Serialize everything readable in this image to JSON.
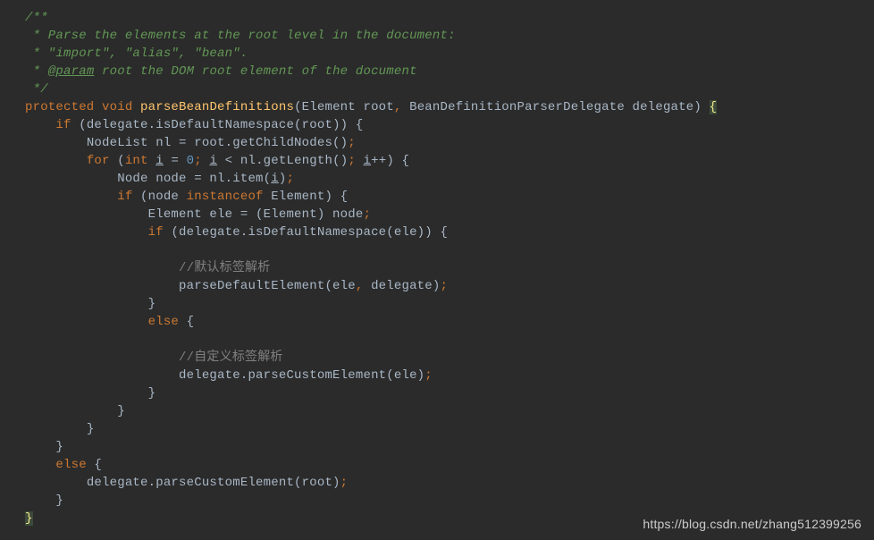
{
  "code": {
    "lines": [
      {
        "indent": 0,
        "segments": [
          {
            "t": "/**",
            "c": "c-docstar"
          }
        ]
      },
      {
        "indent": 0,
        "segments": [
          {
            "t": " * Parse the elements at the root level in the document:",
            "c": "c-docstar"
          }
        ]
      },
      {
        "indent": 0,
        "segments": [
          {
            "t": " * \"import\", \"alias\", \"bean\".",
            "c": "c-docstar"
          }
        ]
      },
      {
        "indent": 0,
        "segments": [
          {
            "t": " * ",
            "c": "c-docstar"
          },
          {
            "t": "@param",
            "c": "c-doctag"
          },
          {
            "t": " root the DOM root element of the document",
            "c": "c-docstar"
          }
        ]
      },
      {
        "indent": 0,
        "segments": [
          {
            "t": " */",
            "c": "c-docstar"
          }
        ]
      },
      {
        "indent": 0,
        "segments": [
          {
            "t": "protected void ",
            "c": "c-keyword"
          },
          {
            "t": "parseBeanDefinitions",
            "c": "c-method"
          },
          {
            "t": "(",
            "c": ""
          },
          {
            "t": "Element root",
            "c": "c-param"
          },
          {
            "t": ", ",
            "c": "c-keyword"
          },
          {
            "t": "BeanDefinitionParserDelegate delegate",
            "c": "c-param"
          },
          {
            "t": ") ",
            "c": ""
          },
          {
            "t": "{",
            "c": "c-brace-hl"
          }
        ]
      },
      {
        "indent": 1,
        "segments": [
          {
            "t": "if ",
            "c": "c-keyword"
          },
          {
            "t": "(delegate.isDefaultNamespace(root)) {",
            "c": ""
          }
        ]
      },
      {
        "indent": 2,
        "segments": [
          {
            "t": "NodeList nl = root.getChildNodes()",
            "c": ""
          },
          {
            "t": ";",
            "c": "c-keyword"
          }
        ]
      },
      {
        "indent": 2,
        "segments": [
          {
            "t": "for ",
            "c": "c-keyword"
          },
          {
            "t": "(",
            "c": ""
          },
          {
            "t": "int ",
            "c": "c-keyword"
          },
          {
            "t": "i",
            "c": "c-underline"
          },
          {
            "t": " = ",
            "c": ""
          },
          {
            "t": "0",
            "c": "c-number"
          },
          {
            "t": "; ",
            "c": "c-keyword"
          },
          {
            "t": "i",
            "c": "c-underline"
          },
          {
            "t": " < nl.getLength()",
            "c": ""
          },
          {
            "t": "; ",
            "c": "c-keyword"
          },
          {
            "t": "i",
            "c": "c-underline"
          },
          {
            "t": "++) {",
            "c": ""
          }
        ]
      },
      {
        "indent": 3,
        "segments": [
          {
            "t": "Node node = nl.item(",
            "c": ""
          },
          {
            "t": "i",
            "c": "c-underline"
          },
          {
            "t": ")",
            "c": ""
          },
          {
            "t": ";",
            "c": "c-keyword"
          }
        ]
      },
      {
        "indent": 3,
        "segments": [
          {
            "t": "if ",
            "c": "c-keyword"
          },
          {
            "t": "(node ",
            "c": ""
          },
          {
            "t": "instanceof ",
            "c": "c-keyword"
          },
          {
            "t": "Element) {",
            "c": ""
          }
        ]
      },
      {
        "indent": 4,
        "segments": [
          {
            "t": "Element ele = (Element) node",
            "c": ""
          },
          {
            "t": ";",
            "c": "c-keyword"
          }
        ]
      },
      {
        "indent": 4,
        "segments": [
          {
            "t": "if ",
            "c": "c-keyword"
          },
          {
            "t": "(delegate.isDefaultNamespace(ele)) {",
            "c": ""
          }
        ]
      },
      {
        "indent": 4,
        "segments": []
      },
      {
        "indent": 5,
        "segments": [
          {
            "t": "//默认标签解析",
            "c": "c-zh"
          }
        ]
      },
      {
        "indent": 5,
        "segments": [
          {
            "t": "parseDefaultElement(ele",
            "c": ""
          },
          {
            "t": ", ",
            "c": "c-keyword"
          },
          {
            "t": "delegate)",
            "c": ""
          },
          {
            "t": ";",
            "c": "c-keyword"
          }
        ]
      },
      {
        "indent": 4,
        "segments": [
          {
            "t": "}",
            "c": ""
          }
        ]
      },
      {
        "indent": 4,
        "segments": [
          {
            "t": "else ",
            "c": "c-keyword"
          },
          {
            "t": "{",
            "c": ""
          }
        ]
      },
      {
        "indent": 4,
        "segments": []
      },
      {
        "indent": 5,
        "segments": [
          {
            "t": "//自定义标签解析",
            "c": "c-zh"
          }
        ]
      },
      {
        "indent": 5,
        "segments": [
          {
            "t": "delegate.parseCustomElement(ele)",
            "c": ""
          },
          {
            "t": ";",
            "c": "c-keyword"
          }
        ]
      },
      {
        "indent": 4,
        "segments": [
          {
            "t": "}",
            "c": ""
          }
        ]
      },
      {
        "indent": 3,
        "segments": [
          {
            "t": "}",
            "c": ""
          }
        ]
      },
      {
        "indent": 2,
        "segments": [
          {
            "t": "}",
            "c": ""
          }
        ]
      },
      {
        "indent": 1,
        "segments": [
          {
            "t": "}",
            "c": ""
          }
        ]
      },
      {
        "indent": 1,
        "segments": [
          {
            "t": "else ",
            "c": "c-keyword"
          },
          {
            "t": "{",
            "c": ""
          }
        ]
      },
      {
        "indent": 2,
        "segments": [
          {
            "t": "delegate.parseCustomElement(root)",
            "c": ""
          },
          {
            "t": ";",
            "c": "c-keyword"
          }
        ]
      },
      {
        "indent": 1,
        "segments": [
          {
            "t": "}",
            "c": ""
          }
        ]
      },
      {
        "indent": 0,
        "segments": [
          {
            "t": "}",
            "c": "c-brace-hl"
          }
        ]
      }
    ]
  },
  "watermark": "https://blog.csdn.net/zhang512399256"
}
